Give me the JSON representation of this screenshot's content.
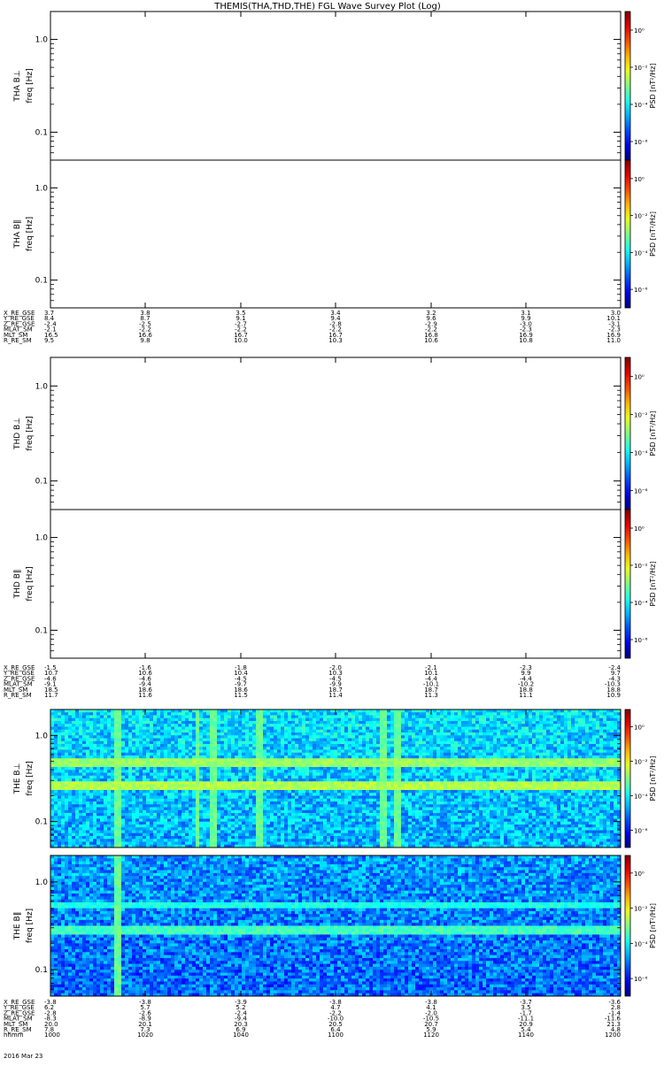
{
  "title": "THEMIS(THA,THD,THE) FGL Wave Survey Plot (Log)",
  "colorbar": {
    "label": "PSD [nT²/Hz]",
    "ticks": [
      "10⁰",
      "10⁻²",
      "10⁻⁴",
      "10⁻⁶"
    ]
  },
  "panels": [
    {
      "probe": "THA",
      "label": "THA B⊥",
      "ylabel": "freq [Hz]",
      "yticks": [
        "1.0",
        "0.1"
      ],
      "has_data": false
    },
    {
      "probe": "THA",
      "label": "THA B∥",
      "ylabel": "freq [Hz]",
      "yticks": [
        "1.0",
        "0.1"
      ],
      "has_data": false
    },
    {
      "probe": "THD",
      "label": "THD B⊥",
      "ylabel": "freq [Hz]",
      "yticks": [
        "1.0",
        "0.1"
      ],
      "has_data": false
    },
    {
      "probe": "THD",
      "label": "THD B∥",
      "ylabel": "freq [Hz]",
      "yticks": [
        "1.0",
        "0.1"
      ],
      "has_data": false
    },
    {
      "probe": "THE",
      "label": "THE B⊥",
      "ylabel": "freq [Hz]",
      "yticks": [
        "1.0",
        "0.1"
      ],
      "has_data": true
    },
    {
      "probe": "THE",
      "label": "THE B∥",
      "ylabel": "freq [Hz]",
      "yticks": [
        "1.0",
        "0.1"
      ],
      "has_data": true
    }
  ],
  "ephemeris": [
    {
      "probe": "THA",
      "rows": [
        {
          "name": "X_RE_GSE",
          "values": [
            "3.7",
            "3.8",
            "3.5",
            "3.4",
            "3.2",
            "3.1",
            "3.0"
          ]
        },
        {
          "name": "Y_RE_GSE",
          "values": [
            "8.4",
            "8.7",
            "9.1",
            "9.4",
            "9.6",
            "9.9",
            "10.1"
          ]
        },
        {
          "name": "Z_RE_GSE",
          "values": [
            "-2.4",
            "-2.5",
            "-2.7",
            "-2.8",
            "-2.9",
            "-3.0",
            "-3.1"
          ]
        },
        {
          "name": "MLAT_SM",
          "values": [
            "-2.1",
            "-2.2",
            "-2.2",
            "-2.2",
            "-2.2",
            "-2.3",
            "-2.3"
          ]
        },
        {
          "name": "MLT_SM",
          "values": [
            "16.5",
            "16.6",
            "16.7",
            "16.7",
            "16.8",
            "16.9",
            "16.9"
          ]
        },
        {
          "name": "R_RE_SM",
          "values": [
            "9.5",
            "9.8",
            "10.0",
            "10.3",
            "10.6",
            "10.8",
            "11.0"
          ]
        }
      ]
    },
    {
      "probe": "THD",
      "rows": [
        {
          "name": "X_RE_GSE",
          "values": [
            "-1.5",
            "-1.6",
            "-1.8",
            "-2.0",
            "-2.1",
            "-2.3",
            "-2.4"
          ]
        },
        {
          "name": "Y_RE_GSE",
          "values": [
            "10.7",
            "10.6",
            "10.4",
            "10.3",
            "10.1",
            "9.9",
            "9.7"
          ]
        },
        {
          "name": "Z_RE_GSE",
          "values": [
            "-4.6",
            "-4.6",
            "-4.5",
            "-4.5",
            "-4.4",
            "-4.4",
            "-4.3"
          ]
        },
        {
          "name": "MLAT_SM",
          "values": [
            "-9.1",
            "-9.4",
            "-9.7",
            "-9.9",
            "-10.1",
            "-10.2",
            "-10.3"
          ]
        },
        {
          "name": "MLT_SM",
          "values": [
            "18.5",
            "18.6",
            "18.6",
            "18.7",
            "18.7",
            "18.8",
            "18.8"
          ]
        },
        {
          "name": "R_RE_SM",
          "values": [
            "11.7",
            "11.6",
            "11.5",
            "11.4",
            "11.3",
            "11.1",
            "10.9"
          ]
        }
      ]
    },
    {
      "probe": "THE",
      "rows": [
        {
          "name": "X_RE_GSE",
          "values": [
            "-3.8",
            "-3.8",
            "-3.9",
            "-3.8",
            "-3.8",
            "-3.7",
            "-3.6"
          ]
        },
        {
          "name": "Y_RE_GSE",
          "values": [
            "6.2",
            "5.7",
            "5.2",
            "4.7",
            "4.1",
            "3.5",
            "2.8"
          ]
        },
        {
          "name": "Z_RE_GSE",
          "values": [
            "-2.8",
            "-2.6",
            "-2.4",
            "-2.2",
            "-2.0",
            "-1.7",
            "-1.4"
          ]
        },
        {
          "name": "MLAT_SM",
          "values": [
            "-8.3",
            "-8.9",
            "-9.4",
            "-10.0",
            "-10.5",
            "-11.1",
            "-11.6"
          ]
        },
        {
          "name": "MLT_SM",
          "values": [
            "20.0",
            "20.1",
            "20.3",
            "20.5",
            "20.7",
            "20.9",
            "21.3"
          ]
        },
        {
          "name": "R_RE_SM",
          "values": [
            "7.8",
            "7.3",
            "6.9",
            "6.4",
            "5.9",
            "5.4",
            "4.8"
          ]
        },
        {
          "name": "hhmm",
          "values": [
            "1000",
            "1020",
            "1040",
            "1100",
            "1120",
            "1140",
            "1200"
          ]
        }
      ]
    }
  ],
  "date_label": "2016 Mar 23",
  "chart_data": {
    "type": "heatmap",
    "title": "THEMIS(THA,THD,THE) FGL Wave Survey Plot (Log)",
    "x": [
      "1000",
      "1020",
      "1040",
      "1100",
      "1120",
      "1140",
      "1200"
    ],
    "xlabel": "hhmm",
    "ylabel": "freq [Hz]",
    "yscale": "log",
    "ylim": [
      0.05,
      2.0
    ],
    "colorscale": "log",
    "zlabel": "PSD [nT²/Hz]",
    "zlim": [
      1e-07,
      10
    ],
    "series": [
      {
        "name": "THA B⊥",
        "has_data": false
      },
      {
        "name": "THA B∥",
        "has_data": false
      },
      {
        "name": "THD B⊥",
        "has_data": false
      },
      {
        "name": "THD B∥",
        "has_data": false
      },
      {
        "name": "THE B⊥",
        "has_data": true,
        "background_log_psd": -4.6,
        "bright_bands_hz": [
          0.48,
          0.26
        ],
        "bright_bands_log_psd": [
          -2.8,
          -2.6
        ],
        "bright_streak_times": [
          "1014",
          "1031",
          "1034",
          "1044",
          "1110",
          "1113"
        ]
      },
      {
        "name": "THE B∥",
        "has_data": true,
        "background_log_psd": -5.2,
        "bright_bands_hz": [
          0.55,
          0.28
        ],
        "bright_bands_log_psd": [
          -3.8,
          -3.5
        ],
        "bright_streak_times": [
          "1014"
        ]
      }
    ]
  }
}
